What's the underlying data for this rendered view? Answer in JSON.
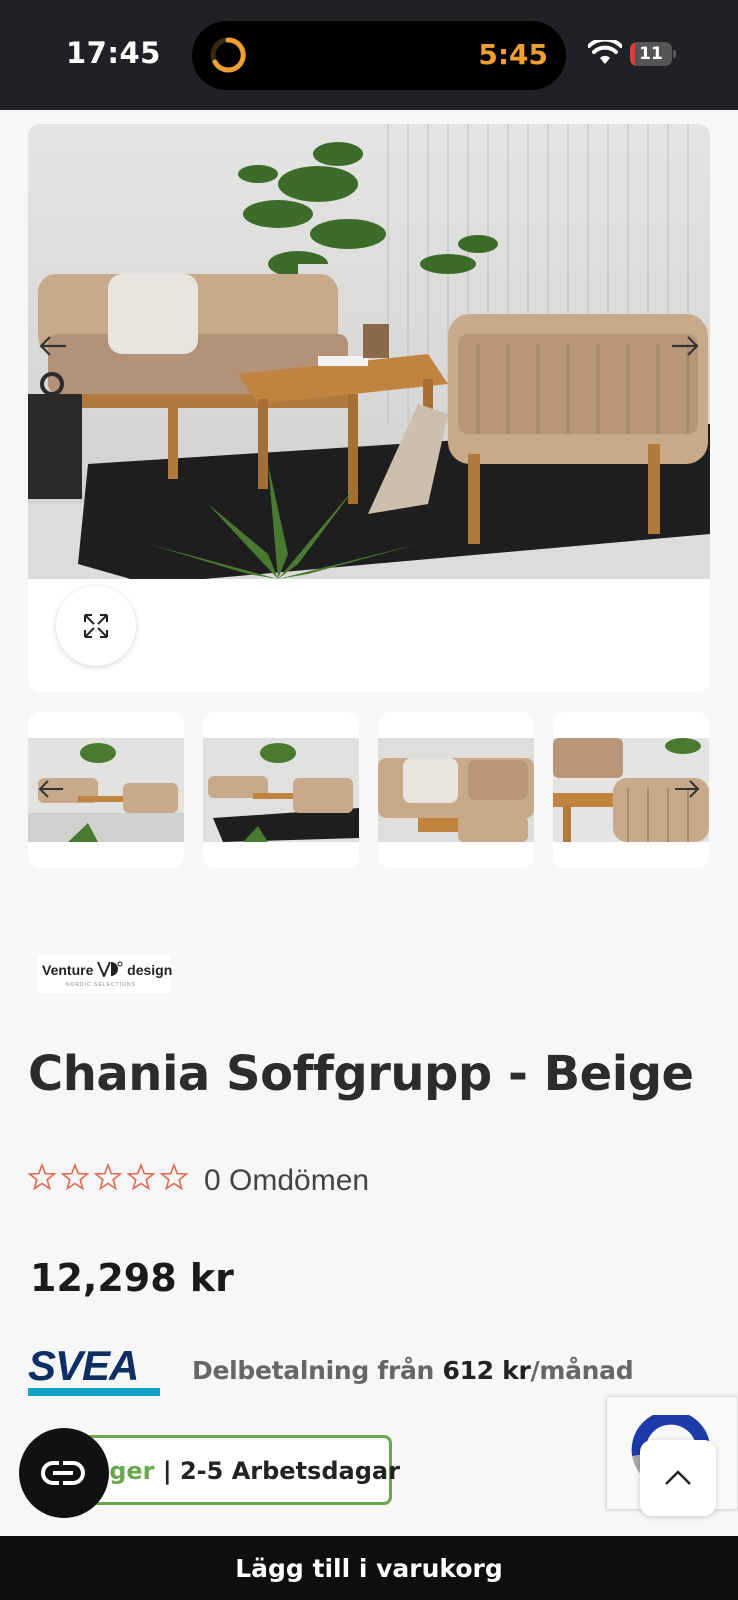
{
  "status_bar": {
    "time": "17:45",
    "timer_time": "5:45",
    "battery_level": "11",
    "battery_fraction": 0.11,
    "colors": {
      "timer": "#f0a030",
      "battery_low": "#e53935"
    }
  },
  "gallery": {
    "main_image": "outdoor-sofa-set-photo",
    "prev_icon": "arrow-left-icon",
    "next_icon": "arrow-right-icon",
    "expand_icon": "expand-icon",
    "thumbnails": [
      "thumbnail-1",
      "thumbnail-2",
      "thumbnail-3",
      "thumbnail-4"
    ]
  },
  "brand": {
    "name_left": "Venture",
    "name_right": "design",
    "tagline": "NORDIC SELECTIONS"
  },
  "product": {
    "title": "Chania Soffgrupp - Beige",
    "rating_stars": 0,
    "rating_max": 5,
    "reviews_label": "0 Omdömen",
    "price": "12,298 kr"
  },
  "financing": {
    "provider": "SVEA",
    "prefix": "Delbetalning från ",
    "amount": "612 kr",
    "suffix": "/månad",
    "colors": {
      "svea_blue": "#0d2f63",
      "svea_cyan": "#12a3c7"
    }
  },
  "delivery": {
    "status": "ager",
    "separator": " | ",
    "time": "2-5 Arbetsdagar",
    "color": "#6aa84f"
  },
  "actions": {
    "chat_icon": "chat-icon",
    "scroll_top_icon": "chevron-up-icon",
    "add_to_cart": "Lägg till i varukorg"
  }
}
